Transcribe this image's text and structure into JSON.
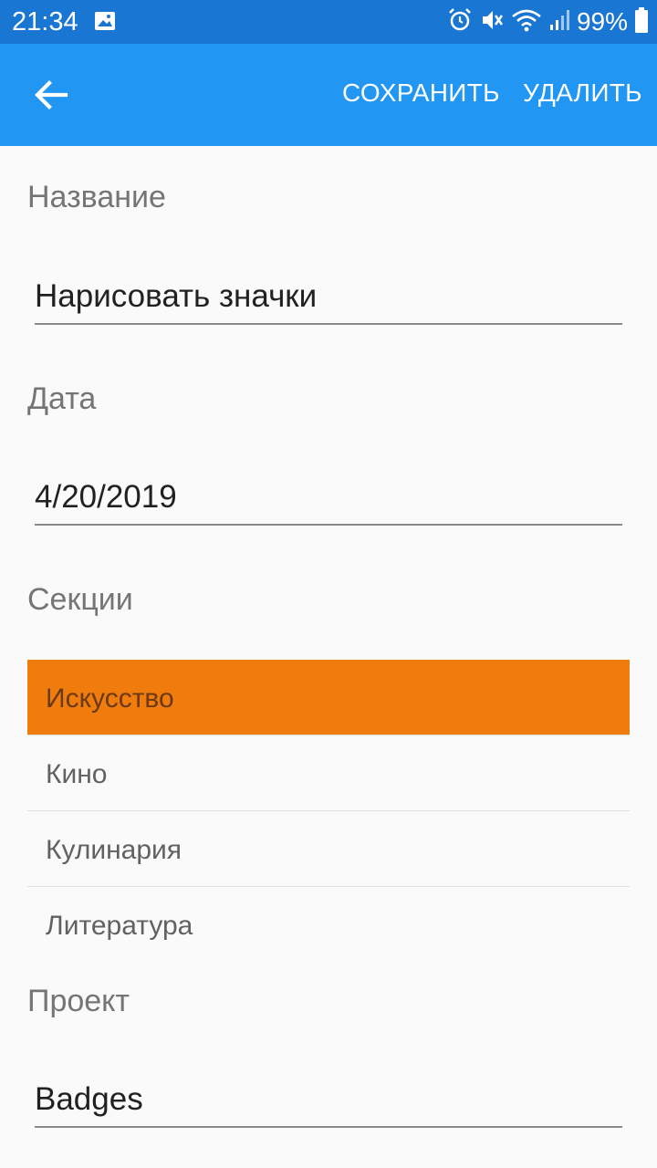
{
  "status_bar": {
    "time": "21:34",
    "battery": "99%",
    "icons": [
      "gallery-icon",
      "alarm-icon",
      "mute-icon",
      "wifi-icon",
      "signal-icon",
      "battery-icon"
    ]
  },
  "app_bar": {
    "back_icon": "arrow-left-icon",
    "save_label": "СОХРАНИТЬ",
    "delete_label": "УДАЛИТЬ"
  },
  "form": {
    "name_label": "Название",
    "name_value": "Нарисовать значки",
    "date_label": "Дата",
    "date_value": "4/20/2019",
    "sections_label": "Секции",
    "sections": [
      {
        "label": "Искусство",
        "selected": true
      },
      {
        "label": "Кино",
        "selected": false
      },
      {
        "label": "Кулинария",
        "selected": false
      },
      {
        "label": "Литература",
        "selected": false
      }
    ],
    "project_label": "Проект",
    "project_value": "Badges"
  },
  "colors": {
    "status_bar": "#1976d2",
    "app_bar": "#2196f3",
    "selected_item": "#f17c0e",
    "background": "#fafafa"
  }
}
